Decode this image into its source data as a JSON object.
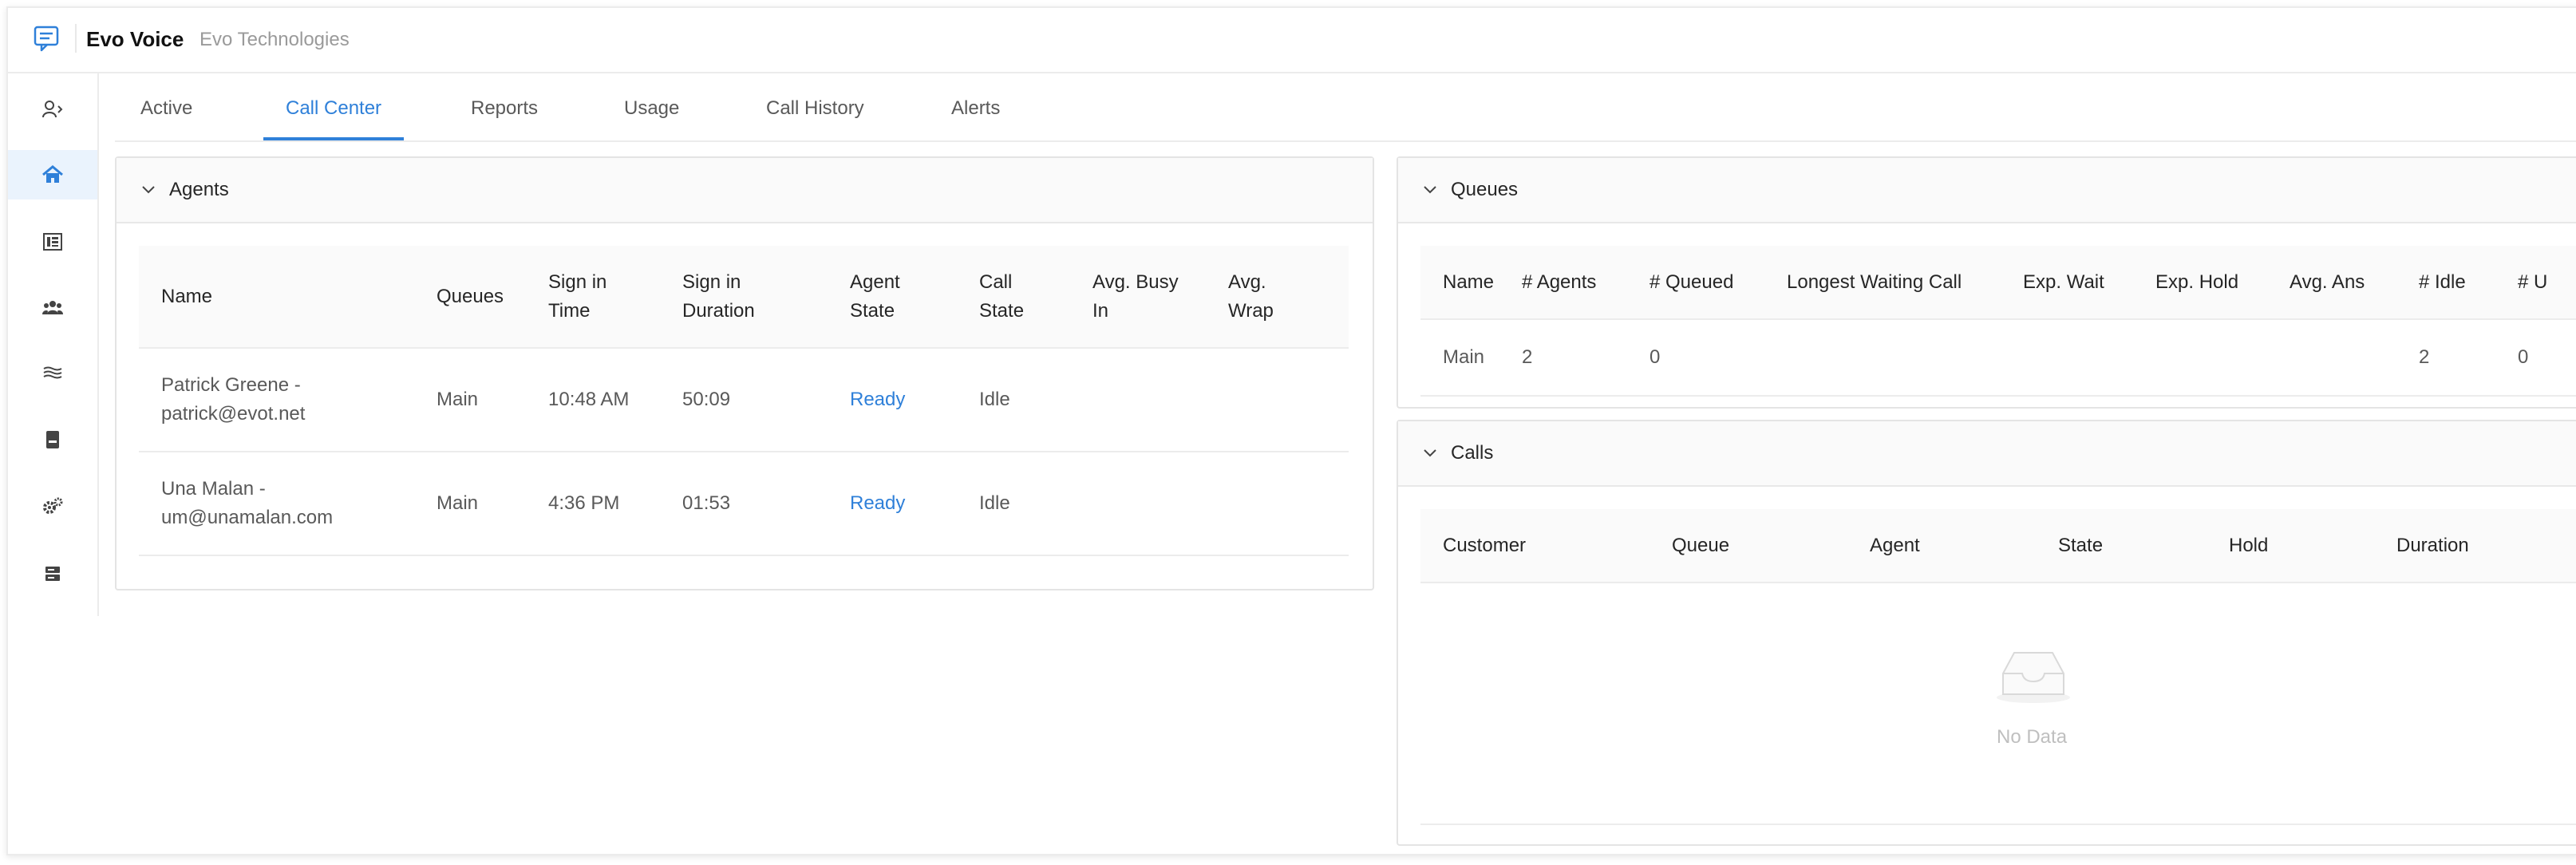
{
  "brand": {
    "name": "Evo Voice",
    "org": "Evo Technologies",
    "icon": "chat-icon"
  },
  "nav": [
    {
      "icon": "user-switch-icon",
      "active": false
    },
    {
      "icon": "home-icon",
      "active": true
    },
    {
      "icon": "dashboard-icon",
      "active": false
    },
    {
      "icon": "users-icon",
      "active": false
    },
    {
      "icon": "flows-icon",
      "active": false
    },
    {
      "icon": "phone-book-icon",
      "active": false
    },
    {
      "icon": "settings-icon",
      "active": false
    },
    {
      "icon": "server-icon",
      "active": false
    }
  ],
  "tabs": [
    {
      "label": "Active"
    },
    {
      "label": "Call Center"
    },
    {
      "label": "Reports"
    },
    {
      "label": "Usage"
    },
    {
      "label": "Call History"
    },
    {
      "label": "Alerts"
    }
  ],
  "active_tab": "Call Center",
  "accent_color": "#2f80d9",
  "agents": {
    "title": "Agents",
    "columns": [
      [
        "Name"
      ],
      [
        "Queues"
      ],
      [
        "Sign in",
        "Time"
      ],
      [
        "Sign in",
        "Duration"
      ],
      [
        "Agent",
        "State"
      ],
      [
        "Call",
        "State"
      ],
      [
        "Avg. Busy",
        "In"
      ],
      [
        "Avg.",
        "Wrap"
      ]
    ],
    "rows": [
      {
        "name": [
          "Patrick Greene -",
          "patrick@evot.net"
        ],
        "queues": "Main",
        "sign_in_time": "10:48 AM",
        "sign_in_duration": "50:09",
        "agent_state": "Ready",
        "call_state": "Idle",
        "avg_busy_in": "",
        "avg_wrap": ""
      },
      {
        "name": [
          "Una Malan -",
          "um@unamalan.com"
        ],
        "queues": "Main",
        "sign_in_time": "4:36 PM",
        "sign_in_duration": "01:53",
        "agent_state": "Ready",
        "call_state": "Idle",
        "avg_busy_in": "",
        "avg_wrap": ""
      }
    ]
  },
  "queues": {
    "title": "Queues",
    "columns": [
      "Name",
      "# Agents",
      "# Queued",
      "Longest Waiting Call",
      "Exp. Wait",
      "Exp. Hold",
      "Avg. Ans",
      "# Idle",
      "# U"
    ],
    "rows": [
      [
        "Main",
        "2",
        "0",
        "",
        "",
        "",
        "",
        "2",
        "0"
      ]
    ]
  },
  "calls": {
    "title": "Calls",
    "columns": [
      "Customer",
      "Queue",
      "Agent",
      "State",
      "Hold",
      "Duration"
    ],
    "empty_text": "No Data",
    "empty_icon": "inbox-icon"
  }
}
